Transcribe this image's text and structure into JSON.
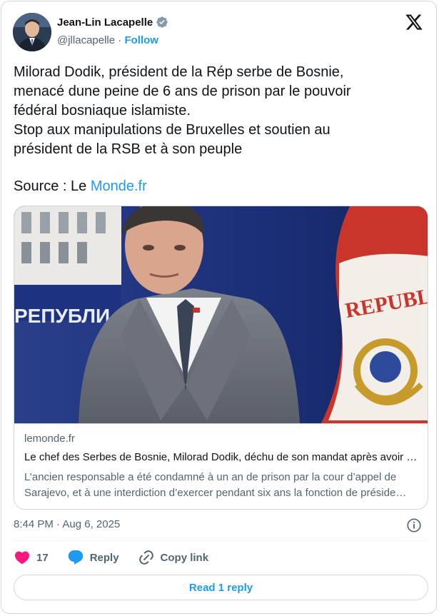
{
  "author": {
    "display_name": "Jean-Lin Lacapelle",
    "handle": "@jllacapelle",
    "separator": "·",
    "follow_label": "Follow"
  },
  "tweet": {
    "text": "Milorad Dodik, président de la Rép serbe de Bosnie,\nmenacé dune peine de 6 ans de prison par le pouvoir\nfédéral bosniaque islamiste.\nStop aux manipulations de Bruxelles et soutien au\nprésident de la RSB et à son peuple",
    "source_prefix": "Source : Le ",
    "source_link": "Monde.fr"
  },
  "link_card": {
    "photo_text": "РЕПУБЛИ",
    "flag_text": "REPUBLI",
    "domain": "lemonde.fr",
    "headline": "Le chef des Serbes de Bosnie, Milorad Dodik, déchu de son mandat après avoir été condamné",
    "description": "L’ancien responsable a été condamné à un an de prison par la cour d’appel de Sarajevo, et à une interdiction d’exercer pendant six ans la fonction de président de la République serbe."
  },
  "meta": {
    "timestamp": "8:44 PM · Aug 6, 2025"
  },
  "actions": {
    "like_count": "17",
    "reply_label": "Reply",
    "copy_link_label": "Copy link",
    "read_replies_label": "Read 1 reply"
  },
  "colors": {
    "accent": "#1d9bf0",
    "like": "#f91880",
    "text": "#0f1419",
    "muted": "#536471"
  }
}
